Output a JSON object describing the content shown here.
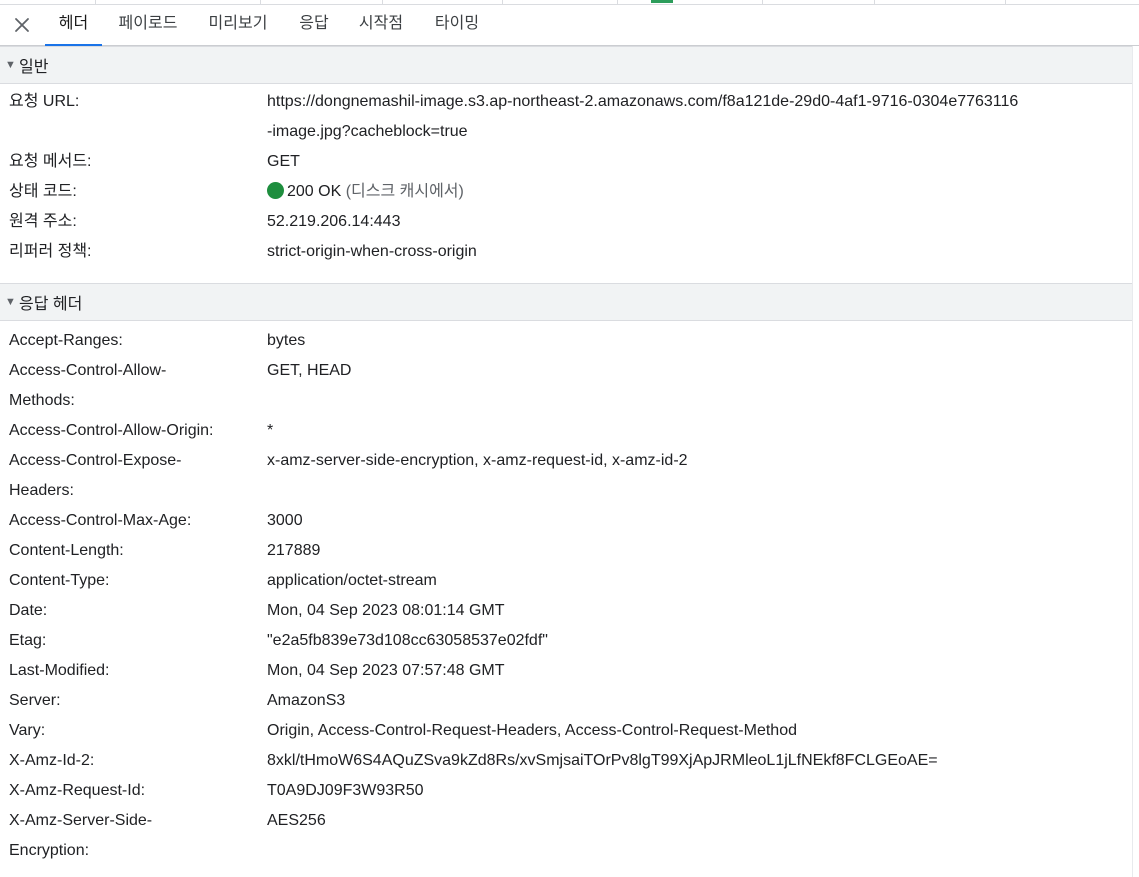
{
  "tabs": [
    {
      "label": "헤더",
      "active": true
    },
    {
      "label": "페이로드",
      "active": false
    },
    {
      "label": "미리보기",
      "active": false
    },
    {
      "label": "응답",
      "active": false
    },
    {
      "label": "시작점",
      "active": false
    },
    {
      "label": "타이밍",
      "active": false
    }
  ],
  "general": {
    "title": "일반",
    "url_label": "요청 URL:",
    "url_line1": "https://dongnemashil-image.s3.ap-northeast-2.amazonaws.com/f8a121de-29d0-4af1-9716-0304e7763116",
    "url_line2": "-image.jpg?cacheblock=true",
    "method_label": "요청 메서드:",
    "method_value": "GET",
    "status_label": "상태 코드:",
    "status_value": "200 OK",
    "status_note": "(디스크 캐시에서)",
    "status_color": "#1e8e3e",
    "remote_label": "원격 주소:",
    "remote_value": "52.219.206.14:443",
    "referrer_label": "리퍼러 정책:",
    "referrer_value": "strict-origin-when-cross-origin"
  },
  "response": {
    "title": "응답 헤더",
    "headers": [
      {
        "k1": "Accept-Ranges:",
        "k2": "",
        "v": "bytes"
      },
      {
        "k1": "Access-Control-Allow-",
        "k2": "Methods:",
        "v": "GET, HEAD"
      },
      {
        "k1": "Access-Control-Allow-Origin:",
        "k2": "",
        "v": "*"
      },
      {
        "k1": "Access-Control-Expose-",
        "k2": "Headers:",
        "v": "x-amz-server-side-encryption, x-amz-request-id, x-amz-id-2"
      },
      {
        "k1": "Access-Control-Max-Age:",
        "k2": "",
        "v": "3000"
      },
      {
        "k1": "Content-Length:",
        "k2": "",
        "v": "217889"
      },
      {
        "k1": "Content-Type:",
        "k2": "",
        "v": "application/octet-stream"
      },
      {
        "k1": "Date:",
        "k2": "",
        "v": "Mon, 04 Sep 2023 08:01:14 GMT"
      },
      {
        "k1": "Etag:",
        "k2": "",
        "v": "\"e2a5fb839e73d108cc63058537e02fdf\""
      },
      {
        "k1": "Last-Modified:",
        "k2": "",
        "v": "Mon, 04 Sep 2023 07:57:48 GMT"
      },
      {
        "k1": "Server:",
        "k2": "",
        "v": "AmazonS3"
      },
      {
        "k1": "Vary:",
        "k2": "",
        "v": "Origin, Access-Control-Request-Headers, Access-Control-Request-Method"
      },
      {
        "k1": "X-Amz-Id-2:",
        "k2": "",
        "v": "8xkl/tHmoW6S4AQuZSva9kZd8Rs/xvSmjsaiTOrPv8lgT99XjApJRMleoL1jLfNEkf8FCLGEoAE="
      },
      {
        "k1": "X-Amz-Request-Id:",
        "k2": "",
        "v": "T0A9DJ09F3W93R50"
      },
      {
        "k1": "X-Amz-Server-Side-",
        "k2": "Encryption:",
        "v": "AES256"
      }
    ]
  }
}
